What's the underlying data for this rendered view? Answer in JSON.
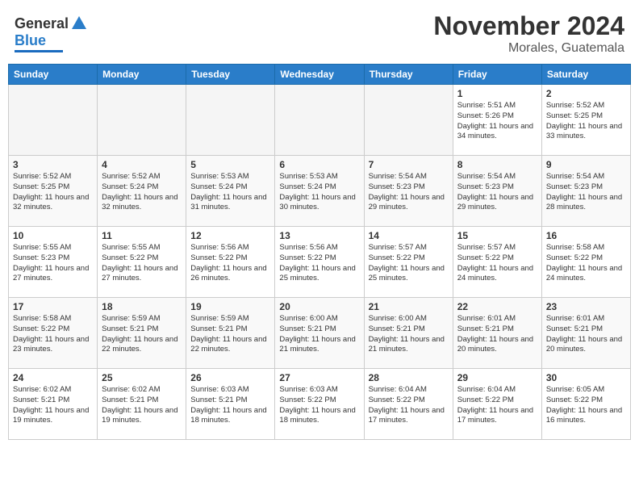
{
  "header": {
    "logo": {
      "general": "General",
      "blue": "Blue",
      "tagline": "GeneralBlue"
    },
    "month_title": "November 2024",
    "location": "Morales, Guatemala"
  },
  "days_of_week": [
    "Sunday",
    "Monday",
    "Tuesday",
    "Wednesday",
    "Thursday",
    "Friday",
    "Saturday"
  ],
  "weeks": [
    [
      {
        "day": "",
        "empty": true
      },
      {
        "day": "",
        "empty": true
      },
      {
        "day": "",
        "empty": true
      },
      {
        "day": "",
        "empty": true
      },
      {
        "day": "",
        "empty": true
      },
      {
        "day": "1",
        "sunrise": "Sunrise: 5:51 AM",
        "sunset": "Sunset: 5:26 PM",
        "daylight": "Daylight: 11 hours and 34 minutes."
      },
      {
        "day": "2",
        "sunrise": "Sunrise: 5:52 AM",
        "sunset": "Sunset: 5:25 PM",
        "daylight": "Daylight: 11 hours and 33 minutes."
      }
    ],
    [
      {
        "day": "3",
        "sunrise": "Sunrise: 5:52 AM",
        "sunset": "Sunset: 5:25 PM",
        "daylight": "Daylight: 11 hours and 32 minutes."
      },
      {
        "day": "4",
        "sunrise": "Sunrise: 5:52 AM",
        "sunset": "Sunset: 5:24 PM",
        "daylight": "Daylight: 11 hours and 32 minutes."
      },
      {
        "day": "5",
        "sunrise": "Sunrise: 5:53 AM",
        "sunset": "Sunset: 5:24 PM",
        "daylight": "Daylight: 11 hours and 31 minutes."
      },
      {
        "day": "6",
        "sunrise": "Sunrise: 5:53 AM",
        "sunset": "Sunset: 5:24 PM",
        "daylight": "Daylight: 11 hours and 30 minutes."
      },
      {
        "day": "7",
        "sunrise": "Sunrise: 5:54 AM",
        "sunset": "Sunset: 5:23 PM",
        "daylight": "Daylight: 11 hours and 29 minutes."
      },
      {
        "day": "8",
        "sunrise": "Sunrise: 5:54 AM",
        "sunset": "Sunset: 5:23 PM",
        "daylight": "Daylight: 11 hours and 29 minutes."
      },
      {
        "day": "9",
        "sunrise": "Sunrise: 5:54 AM",
        "sunset": "Sunset: 5:23 PM",
        "daylight": "Daylight: 11 hours and 28 minutes."
      }
    ],
    [
      {
        "day": "10",
        "sunrise": "Sunrise: 5:55 AM",
        "sunset": "Sunset: 5:23 PM",
        "daylight": "Daylight: 11 hours and 27 minutes."
      },
      {
        "day": "11",
        "sunrise": "Sunrise: 5:55 AM",
        "sunset": "Sunset: 5:22 PM",
        "daylight": "Daylight: 11 hours and 27 minutes."
      },
      {
        "day": "12",
        "sunrise": "Sunrise: 5:56 AM",
        "sunset": "Sunset: 5:22 PM",
        "daylight": "Daylight: 11 hours and 26 minutes."
      },
      {
        "day": "13",
        "sunrise": "Sunrise: 5:56 AM",
        "sunset": "Sunset: 5:22 PM",
        "daylight": "Daylight: 11 hours and 25 minutes."
      },
      {
        "day": "14",
        "sunrise": "Sunrise: 5:57 AM",
        "sunset": "Sunset: 5:22 PM",
        "daylight": "Daylight: 11 hours and 25 minutes."
      },
      {
        "day": "15",
        "sunrise": "Sunrise: 5:57 AM",
        "sunset": "Sunset: 5:22 PM",
        "daylight": "Daylight: 11 hours and 24 minutes."
      },
      {
        "day": "16",
        "sunrise": "Sunrise: 5:58 AM",
        "sunset": "Sunset: 5:22 PM",
        "daylight": "Daylight: 11 hours and 24 minutes."
      }
    ],
    [
      {
        "day": "17",
        "sunrise": "Sunrise: 5:58 AM",
        "sunset": "Sunset: 5:22 PM",
        "daylight": "Daylight: 11 hours and 23 minutes."
      },
      {
        "day": "18",
        "sunrise": "Sunrise: 5:59 AM",
        "sunset": "Sunset: 5:21 PM",
        "daylight": "Daylight: 11 hours and 22 minutes."
      },
      {
        "day": "19",
        "sunrise": "Sunrise: 5:59 AM",
        "sunset": "Sunset: 5:21 PM",
        "daylight": "Daylight: 11 hours and 22 minutes."
      },
      {
        "day": "20",
        "sunrise": "Sunrise: 6:00 AM",
        "sunset": "Sunset: 5:21 PM",
        "daylight": "Daylight: 11 hours and 21 minutes."
      },
      {
        "day": "21",
        "sunrise": "Sunrise: 6:00 AM",
        "sunset": "Sunset: 5:21 PM",
        "daylight": "Daylight: 11 hours and 21 minutes."
      },
      {
        "day": "22",
        "sunrise": "Sunrise: 6:01 AM",
        "sunset": "Sunset: 5:21 PM",
        "daylight": "Daylight: 11 hours and 20 minutes."
      },
      {
        "day": "23",
        "sunrise": "Sunrise: 6:01 AM",
        "sunset": "Sunset: 5:21 PM",
        "daylight": "Daylight: 11 hours and 20 minutes."
      }
    ],
    [
      {
        "day": "24",
        "sunrise": "Sunrise: 6:02 AM",
        "sunset": "Sunset: 5:21 PM",
        "daylight": "Daylight: 11 hours and 19 minutes."
      },
      {
        "day": "25",
        "sunrise": "Sunrise: 6:02 AM",
        "sunset": "Sunset: 5:21 PM",
        "daylight": "Daylight: 11 hours and 19 minutes."
      },
      {
        "day": "26",
        "sunrise": "Sunrise: 6:03 AM",
        "sunset": "Sunset: 5:21 PM",
        "daylight": "Daylight: 11 hours and 18 minutes."
      },
      {
        "day": "27",
        "sunrise": "Sunrise: 6:03 AM",
        "sunset": "Sunset: 5:22 PM",
        "daylight": "Daylight: 11 hours and 18 minutes."
      },
      {
        "day": "28",
        "sunrise": "Sunrise: 6:04 AM",
        "sunset": "Sunset: 5:22 PM",
        "daylight": "Daylight: 11 hours and 17 minutes."
      },
      {
        "day": "29",
        "sunrise": "Sunrise: 6:04 AM",
        "sunset": "Sunset: 5:22 PM",
        "daylight": "Daylight: 11 hours and 17 minutes."
      },
      {
        "day": "30",
        "sunrise": "Sunrise: 6:05 AM",
        "sunset": "Sunset: 5:22 PM",
        "daylight": "Daylight: 11 hours and 16 minutes."
      }
    ]
  ]
}
